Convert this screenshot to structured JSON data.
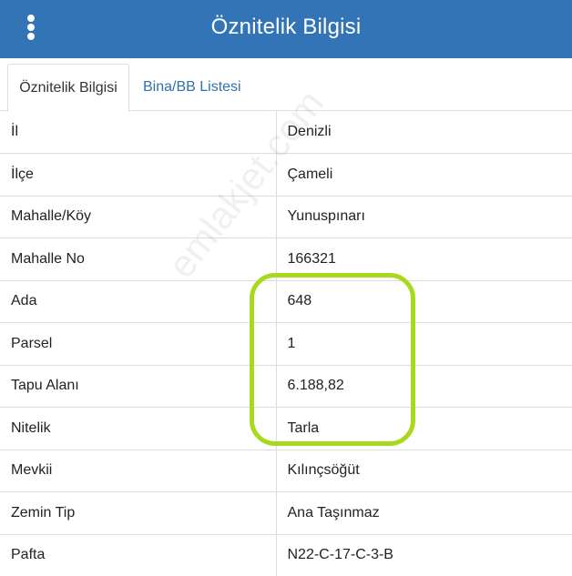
{
  "header": {
    "title": "Öznitelik Bilgisi",
    "menu_icon": "kebab-menu-icon",
    "background_color": "#3274b5"
  },
  "tabs": [
    {
      "label": "Öznitelik Bilgisi",
      "active": true
    },
    {
      "label": "Bina/BB Listesi",
      "active": false
    }
  ],
  "attributes": [
    {
      "key": "İl",
      "value": "Denizli"
    },
    {
      "key": "İlçe",
      "value": "Çameli"
    },
    {
      "key": "Mahalle/Köy",
      "value": "Yunuspınarı"
    },
    {
      "key": "Mahalle No",
      "value": "166321"
    },
    {
      "key": "Ada",
      "value": "648"
    },
    {
      "key": "Parsel",
      "value": "1"
    },
    {
      "key": "Tapu Alanı",
      "value": "6.188,82"
    },
    {
      "key": "Nitelik",
      "value": "Tarla"
    },
    {
      "key": "Mevkii",
      "value": "Kılınçsöğüt"
    },
    {
      "key": "Zemin Tip",
      "value": "Ana Taşınmaz"
    },
    {
      "key": "Pafta",
      "value": "N22-C-17-C-3-B"
    }
  ],
  "overlay": {
    "watermark": "emlakjet.com",
    "highlight_color": "#a8d91e"
  }
}
